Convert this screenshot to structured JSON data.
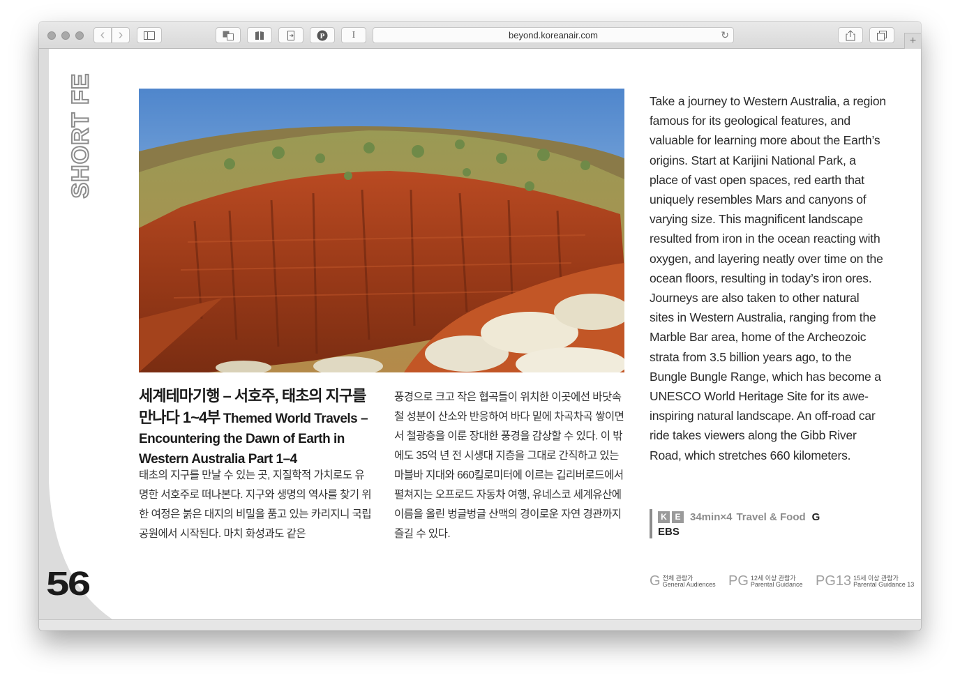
{
  "browser": {
    "url": "beyond.koreanair.com",
    "buttons": {
      "back": "‹",
      "forward": "›",
      "cursor": "I",
      "new_tab": "+"
    }
  },
  "page": {
    "vertical_label": "SHORT FE",
    "page_number": "56",
    "title_ko": "세계테마기행 – 서호주, 태초의 지구를 만나다 1~4부",
    "title_en": "Themed World Travels – Encountering the Dawn of Earth in Western Australia Part 1–4",
    "body_ko_col1": "태초의 지구를 만날 수 있는 곳, 지질학적 가치로도 유명한 서호주로 떠나본다. 지구와 생명의 역사를 찾기 위한 여정은 붉은 대지의 비밀을 품고 있는 카리지니 국립공원에서 시작된다. 마치 화성과도 같은",
    "body_ko_col2": "풍경으로 크고 작은 협곡들이 위치한 이곳에선 바닷속 철 성분이 산소와 반응하여 바다 밑에 차곡차곡 쌓이면서 철광층을 이룬 장대한 풍경을 감상할 수 있다. 이 밖에도 35억 년 전 시생대 지층을 그대로 간직하고 있는 마블바 지대와 660킬로미터에 이르는 깁리버로드에서 펼쳐지는 오프로드 자동차 여행, 유네스코 세계유산에 이름을 올린 벙글벙글 산맥의 경이로운 자연 경관까지 즐길 수 있다.",
    "body_en": "Take a journey to Western Australia, a region famous for its geological features, and valuable for learning more about the Earth’s origins. Start at Karijini National Park, a place of vast open spaces, red earth that uniquely resembles Mars and canyons of varying size. This magnificent landscape resulted from iron in the ocean reacting with oxygen, and layering neatly over time on the ocean floors, resulting in today’s iron ores. Journeys are also taken to other natural sites in Western Australia, ranging from the Marble Bar area, home of the Archeozoic strata from 3.5 billion years ago, to the Bungle Bungle Range, which has become a UNESCO World Heritage Site for its awe-inspiring natural landscape. An off-road car ride takes viewers along the Gibb River Road, which stretches 660 kilometers.",
    "info": {
      "k": "K",
      "e": "E",
      "duration": "34min×4",
      "genre": "Travel & Food",
      "rating": "G",
      "channel": "EBS"
    },
    "ratings_legend": [
      {
        "code": "G",
        "ko": "전체 관람가",
        "en": "General Audiences"
      },
      {
        "code": "PG",
        "ko": "12세 이상 관람가",
        "en": "Parental Guidance"
      },
      {
        "code": "PG13",
        "ko": "15세 이상 관람가",
        "en": "Parental Guidance 13"
      }
    ]
  },
  "colors": {
    "accent_gray": "#8c8c8c",
    "canyon_red": "#a8401c",
    "sky_blue": "#5a8fd0"
  }
}
